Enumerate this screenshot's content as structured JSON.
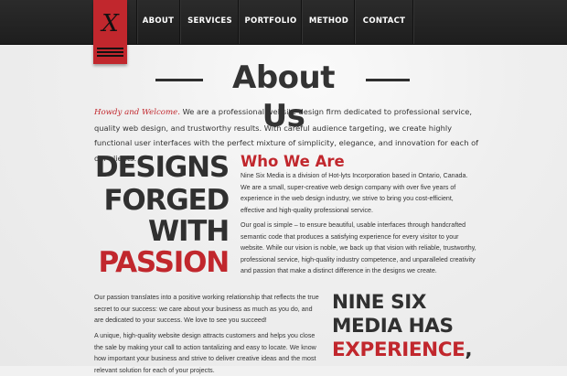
{
  "brand": {
    "logo_letter": "X"
  },
  "nav": {
    "items": [
      {
        "label": "ABOUT"
      },
      {
        "label": "SERVICES"
      },
      {
        "label": "PORTFOLIO"
      },
      {
        "label": "METHOD"
      },
      {
        "label": "CONTACT"
      }
    ]
  },
  "page": {
    "title": "About Us"
  },
  "intro": {
    "lead": "Howdy and Welcome.",
    "text": " We are a professional website design firm dedicated to professional service, quality web design, and trustworthy results. With careful audience targeting, we create highly functional user interfaces with the perfect mixture of simplicity, elegance, and innovation for each of our clients."
  },
  "slogan": {
    "line1": "DESIGNS",
    "line2": "FORGED",
    "line3": "WITH",
    "line4": "PASSION"
  },
  "who": {
    "heading": "Who We Are",
    "para1": "Nine Six Media is a division of Hot-lyts Incorporation based in Ontario, Canada. We are a small, super-creative web design company with over five years of experience in the web design industry, we strive to bring you cost-efficient, effective and high-quality professional service.",
    "para2": "Our goal is simple – to ensure beautiful, usable interfaces through handcrafted semantic code that produces a satisfying experience for every visitor to your website. While our vision is noble, we back up that vision with reliable, trustworthy, professional service, high-quality industry competence, and unparalleled creativity and passion that make a distinct difference in the designs we create."
  },
  "passion": {
    "para1": "Our passion translates into a positive working relationship that reflects the true secret to our success: we care about your business as much as you do, and are dedicated to your success. We love to see you succeed!",
    "para2": "A unique, high-quality website design attracts customers and helps you close the sale by making your call to action tantalizing and easy to locate. We know how important your business and strive to deliver creative ideas and the most relevant solution for each of your projects."
  },
  "experience": {
    "line1": "NINE SIX",
    "line2": "MEDIA HAS",
    "line3": "EXPERIENCE",
    "punct": ","
  },
  "colors": {
    "accent": "#c1272d",
    "nav_bg": "#222222",
    "text": "#333333",
    "background": "#f1f1f1"
  }
}
